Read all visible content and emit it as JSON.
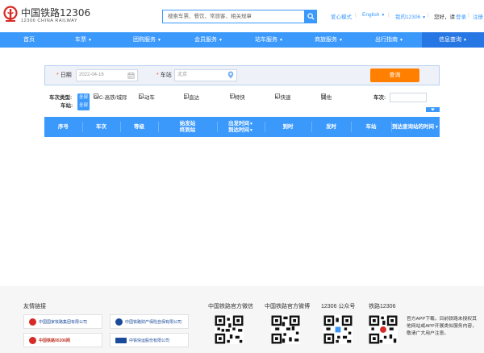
{
  "header": {
    "logo_title": "中国铁路12306",
    "logo_subtitle": "12306 CHINA RAILWAY",
    "search_placeholder": "搜索车票、餐饮、常旅客、相关规章",
    "care_mode": "爱心模式",
    "language": "English",
    "my_account": "我的12306",
    "greeting": "您好，请",
    "login": "登录",
    "register": "注册"
  },
  "nav": {
    "items": [
      {
        "label": "首页"
      },
      {
        "label": "车票"
      },
      {
        "label": "团购服务"
      },
      {
        "label": "会员服务"
      },
      {
        "label": "站车服务"
      },
      {
        "label": "商旅服务"
      },
      {
        "label": "出行指南"
      },
      {
        "label": "信息查询"
      }
    ]
  },
  "query": {
    "date_label": "日期",
    "date_value": "2022-04-16",
    "station_label": "车站",
    "station_value": "北京",
    "submit": "查询"
  },
  "filters": {
    "train_type_label": "车次类型:",
    "all_tag": "全部",
    "types": [
      "G/C-高铁/城际",
      "D-动车",
      "Z-直达",
      "T-特快",
      "K-快速",
      "其他"
    ],
    "train_no_label": "车次:",
    "station_label": "车站:",
    "station_all_tag": "全部"
  },
  "table": {
    "headers": {
      "seq": "序号",
      "train": "车次",
      "grade": "等级",
      "start_line1": "始发站",
      "start_line2": "终到站",
      "dep_line1": "出发时间",
      "dep_line2": "到达时间",
      "arrive": "到时",
      "depart": "发时",
      "station": "车站",
      "arrive_time": "到达查询站的时间"
    }
  },
  "footer": {
    "links_title": "友情链接",
    "partners": [
      "中国国家铁路集团有限公司",
      "中国铁路财产保险自保有限公司",
      "中国铁路95306网",
      "中铁快运股份有限公司"
    ],
    "partner_colors": [
      "#d62b26",
      "#1a4a9a",
      "#d62b26",
      "#1a4a9a"
    ],
    "qr_titles": [
      "中国铁路官方微信",
      "中国铁路官方微博",
      "12306 公众号",
      "铁路12306"
    ],
    "notice": "官方APP下载，目前铁路未授权其他网站或APP开展类似服务内容，敬请广大用户注意。"
  },
  "colors": {
    "primary": "#3b99fc",
    "nav_active": "#2676e3",
    "query_button": "#ff8000",
    "logo_red": "#d62b26"
  }
}
